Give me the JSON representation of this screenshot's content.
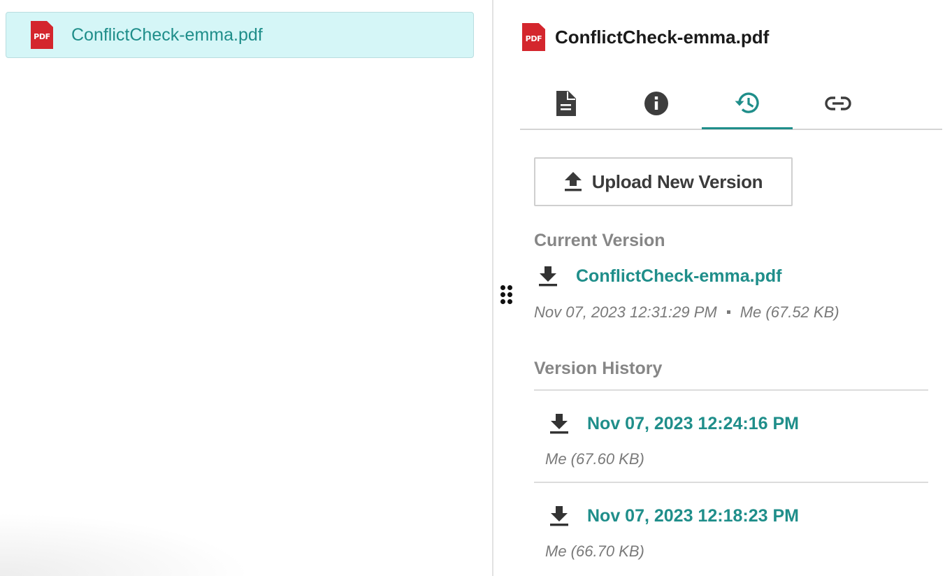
{
  "file_list": {
    "items": [
      {
        "name": "ConflictCheck-emma.pdf",
        "icon_text": "PDF",
        "icon": "pdf-file-icon"
      }
    ]
  },
  "details": {
    "title": "ConflictCheck-emma.pdf",
    "icon_text": "PDF",
    "tabs": [
      {
        "icon": "document-icon",
        "active": false
      },
      {
        "icon": "info-icon",
        "active": false
      },
      {
        "icon": "history-icon",
        "active": true
      },
      {
        "icon": "link-icon",
        "active": false
      }
    ],
    "upload_label": "Upload New Version",
    "current_version_heading": "Current Version",
    "current_version": {
      "name": "ConflictCheck-emma.pdf",
      "timestamp": "Nov 07, 2023 12:31:29 PM",
      "owner_size": "Me (67.52 KB)"
    },
    "version_history_heading": "Version History",
    "history": [
      {
        "timestamp": "Nov 07, 2023 12:24:16 PM",
        "owner_size": "Me (67.60 KB)"
      },
      {
        "timestamp": "Nov 07, 2023 12:18:23 PM",
        "owner_size": "Me (66.70 KB)"
      }
    ]
  },
  "colors": {
    "accent": "#1f8e8a",
    "selected_bg": "#d5f6f7",
    "pdf_red": "#d4262d",
    "muted_text": "#7a7a7a",
    "heading_gray": "#868686"
  }
}
